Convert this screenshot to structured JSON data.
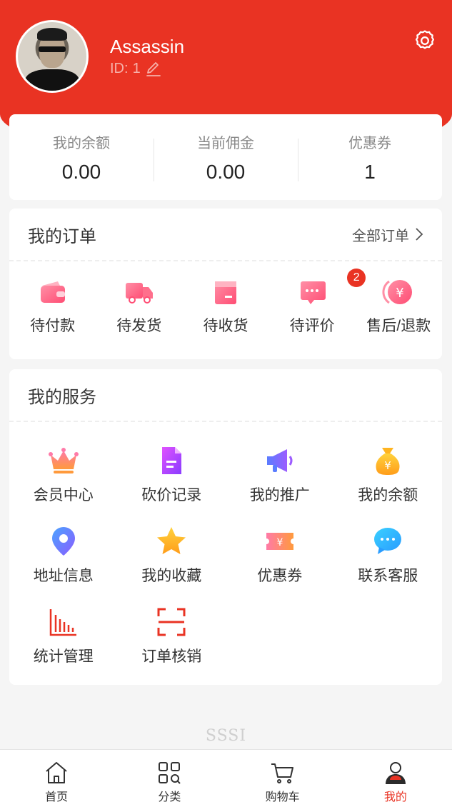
{
  "colors": {
    "brand": "#e93323",
    "badge": "#e93323"
  },
  "user": {
    "name": "Assassin",
    "id_label": "ID:",
    "id_value": "1"
  },
  "stats": [
    {
      "label": "我的余额",
      "value": "0.00"
    },
    {
      "label": "当前佣金",
      "value": "0.00"
    },
    {
      "label": "优惠券",
      "value": "1"
    }
  ],
  "orders": {
    "title": "我的订单",
    "more_label": "全部订单",
    "items": [
      {
        "label": "待付款",
        "icon": "wallet-icon"
      },
      {
        "label": "待发货",
        "icon": "truck-icon"
      },
      {
        "label": "待收货",
        "icon": "box-icon"
      },
      {
        "label": "待评价",
        "icon": "comment-icon",
        "badge": "2"
      },
      {
        "label": "售后/退款",
        "icon": "refund-icon"
      }
    ]
  },
  "services": {
    "title": "我的服务",
    "items": [
      {
        "label": "会员中心",
        "icon": "crown-icon"
      },
      {
        "label": "砍价记录",
        "icon": "document-icon"
      },
      {
        "label": "我的推广",
        "icon": "megaphone-icon"
      },
      {
        "label": "我的余额",
        "icon": "money-bag-icon"
      },
      {
        "label": "地址信息",
        "icon": "location-icon"
      },
      {
        "label": "我的收藏",
        "icon": "star-icon"
      },
      {
        "label": "优惠券",
        "icon": "coupon-icon"
      },
      {
        "label": "联系客服",
        "icon": "chat-icon"
      },
      {
        "label": "统计管理",
        "icon": "chart-icon"
      },
      {
        "label": "订单核销",
        "icon": "scan-icon"
      }
    ]
  },
  "footer_brand": "SSSI",
  "tabbar": {
    "items": [
      {
        "label": "首页",
        "icon": "home-icon"
      },
      {
        "label": "分类",
        "icon": "category-icon"
      },
      {
        "label": "购物车",
        "icon": "cart-icon"
      },
      {
        "label": "我的",
        "icon": "user-icon",
        "active": true
      }
    ]
  }
}
